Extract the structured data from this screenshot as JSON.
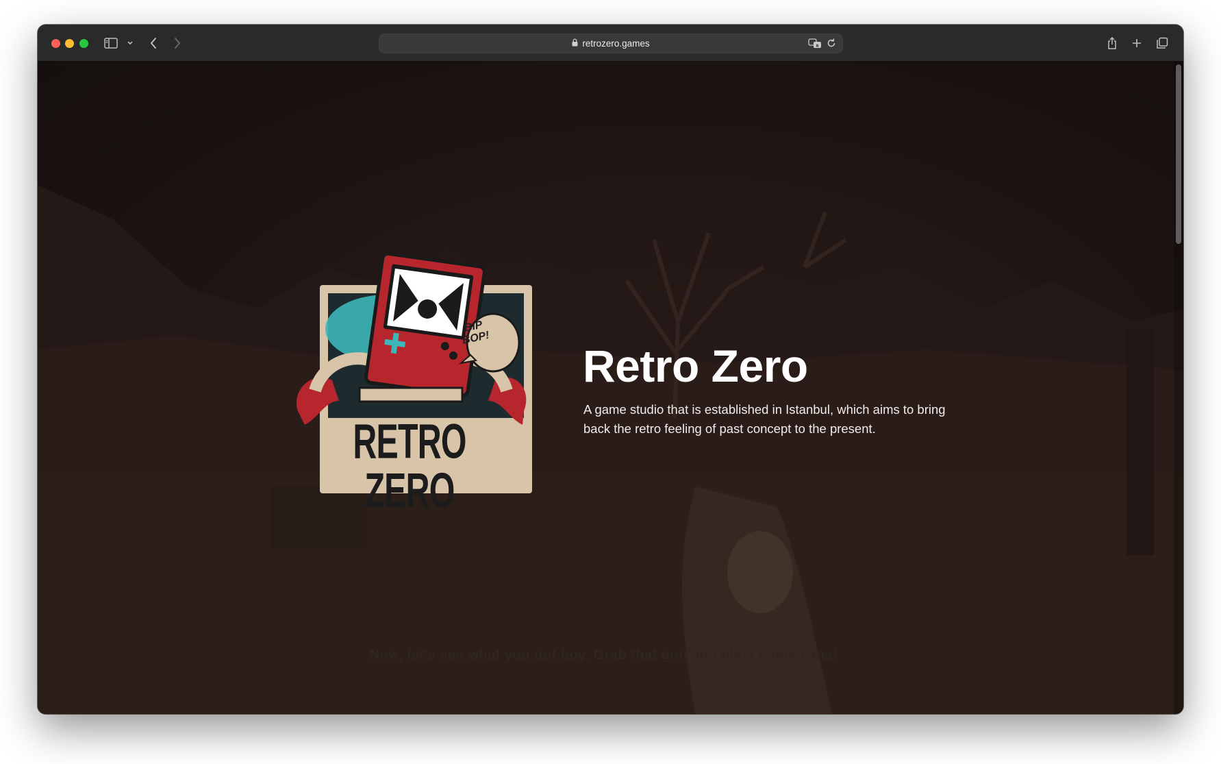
{
  "browser": {
    "url": "retrozero.games",
    "colors": {
      "close": "#fe5f57",
      "minimize": "#febc2e",
      "zoom": "#28c840",
      "toolbar": "#2a2a2a"
    },
    "icons": [
      "sidebar-icon",
      "chevron-down-icon",
      "back-icon",
      "forward-icon",
      "lock-icon",
      "translate-icon",
      "reload-icon",
      "share-icon",
      "new-tab-icon",
      "tab-overview-icon"
    ]
  },
  "hero": {
    "title": "Retro Zero",
    "description": "A game studio that is established in Istanbul, which aims to bring back the retro feeling of past concept to the present."
  },
  "logo": {
    "wordmark": "RETRO ZERO",
    "bubble_line1": "BIP",
    "bubble_line2": "BOP!",
    "colors": {
      "frame": "#d8c4a8",
      "red": "#b8262d",
      "teal": "#3cb6b8"
    }
  },
  "background": {
    "subtitle": "Now, let's see what you got boy. Grab that gun and blast some cans!"
  }
}
